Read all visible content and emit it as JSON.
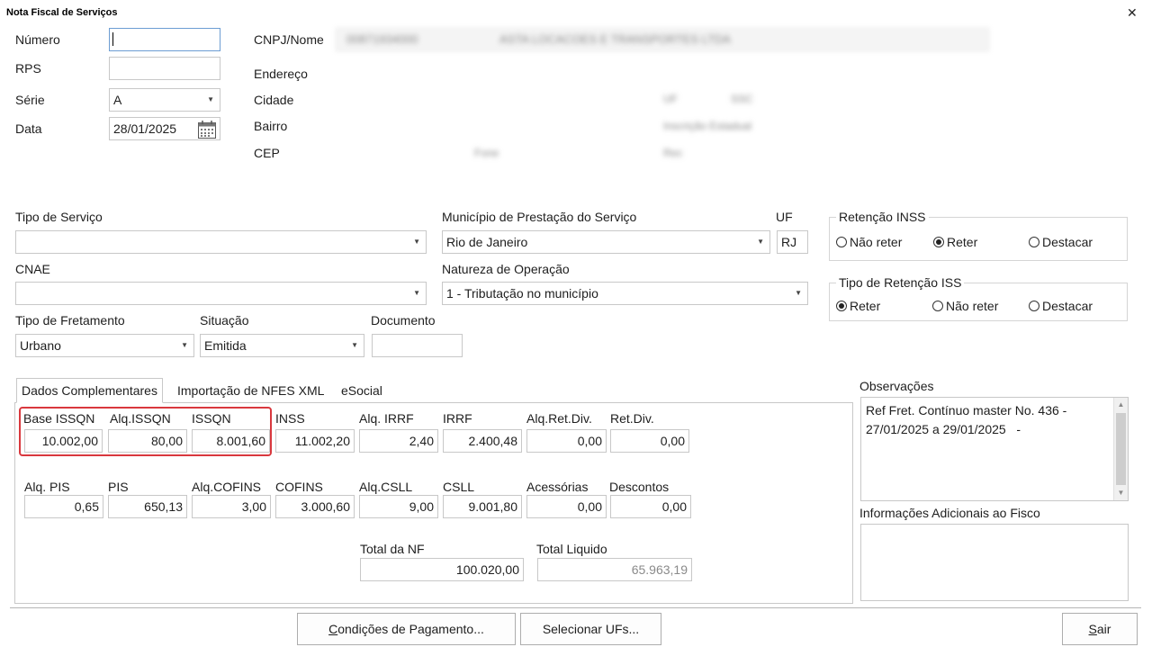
{
  "window": {
    "title": "Nota Fiscal de Serviços",
    "close_glyph": "✕"
  },
  "header": {
    "numero": {
      "label": "Número",
      "value": ""
    },
    "rps": {
      "label": "RPS",
      "value": ""
    },
    "serie": {
      "label": "Série",
      "value": "A"
    },
    "data": {
      "label": "Data",
      "value": "28/01/2025"
    },
    "cnpj_label": "CNPJ/Nome",
    "endereco_label": "Endereço",
    "cidade_label": "Cidade",
    "bairro_label": "Bairro",
    "cep_label": "CEP",
    "redacted": {
      "cnpj": "00871934000",
      "nome": "ASTA LOCACOES E TRANSPORTES LTDA",
      "uf": "UF",
      "uf_val": "SSC",
      "inscricao": "Inscrição Estadual",
      "fone": "Fone",
      "rec": "Rec"
    }
  },
  "form": {
    "tipo_servico": {
      "label": "Tipo de Serviço",
      "value": ""
    },
    "municipio": {
      "label": "Município de Prestação do Serviço",
      "value": "Rio de Janeiro"
    },
    "uf": {
      "label": "UF",
      "value": "RJ"
    },
    "cnae": {
      "label": "CNAE",
      "value": ""
    },
    "natureza": {
      "label": "Natureza de Operação",
      "value": "1 - Tributação no município"
    },
    "tipo_fretamento": {
      "label": "Tipo de Fretamento",
      "value": "Urbano"
    },
    "situacao": {
      "label": "Situação",
      "value": "Emitida"
    },
    "documento": {
      "label": "Documento",
      "value": ""
    }
  },
  "retencao_inss": {
    "title": "Retenção INSS",
    "options": [
      "Não reter",
      "Reter",
      "Destacar"
    ],
    "selected": "Reter"
  },
  "tipo_retencao_iss": {
    "title": "Tipo de Retenção ISS",
    "options": [
      "Reter",
      "Não reter",
      "Destacar"
    ],
    "selected": "Reter"
  },
  "tabs": [
    "Dados Complementares",
    "Importação de NFES XML",
    "eSocial"
  ],
  "active_tab": "Dados Complementares",
  "taxes_row1": [
    {
      "label": "Base ISSQN",
      "value": "10.002,00"
    },
    {
      "label": "Alq.ISSQN",
      "value": "80,00"
    },
    {
      "label": "ISSQN",
      "value": "8.001,60"
    },
    {
      "label": "INSS",
      "value": "11.002,20"
    },
    {
      "label": "Alq. IRRF",
      "value": "2,40"
    },
    {
      "label": "IRRF",
      "value": "2.400,48"
    },
    {
      "label": "Alq.Ret.Div.",
      "value": "0,00"
    },
    {
      "label": "Ret.Div.",
      "value": "0,00"
    }
  ],
  "taxes_row2": [
    {
      "label": "Alq. PIS",
      "value": "0,65"
    },
    {
      "label": "PIS",
      "value": "650,13"
    },
    {
      "label": "Alq.COFINS",
      "value": "3,00"
    },
    {
      "label": "COFINS",
      "value": "3.000,60"
    },
    {
      "label": "Alq.CSLL",
      "value": "9,00"
    },
    {
      "label": "CSLL",
      "value": "9.001,80"
    },
    {
      "label": "Acessórias",
      "value": "0,00"
    },
    {
      "label": "Descontos",
      "value": "0,00"
    }
  ],
  "totals": {
    "total_nf": {
      "label": "Total da NF",
      "value": "100.020,00"
    },
    "total_liquido": {
      "label": "Total Liquido",
      "value": "65.963,19"
    }
  },
  "observacoes": {
    "label": "Observações",
    "value": "Ref Fret. Contínuo master No. 436 -\n27/01/2025 a 29/01/2025   -"
  },
  "info_fisco": {
    "label": "Informações Adicionais ao Fisco",
    "value": ""
  },
  "buttons": {
    "condicoes": {
      "mnemonic": "C",
      "rest": "ondições de Pagamento..."
    },
    "ufs": {
      "label": "Selecionar UFs..."
    },
    "sair": {
      "mnemonic": "S",
      "rest": "air"
    }
  },
  "icons": {
    "calendar": "calendar-icon",
    "dropdown": "chevron-down-icon",
    "close": "close-icon"
  },
  "colors": {
    "highlight": "#d9383e",
    "focus_border": "#6c9dd3",
    "readonly_text": "#8a8a8a"
  }
}
